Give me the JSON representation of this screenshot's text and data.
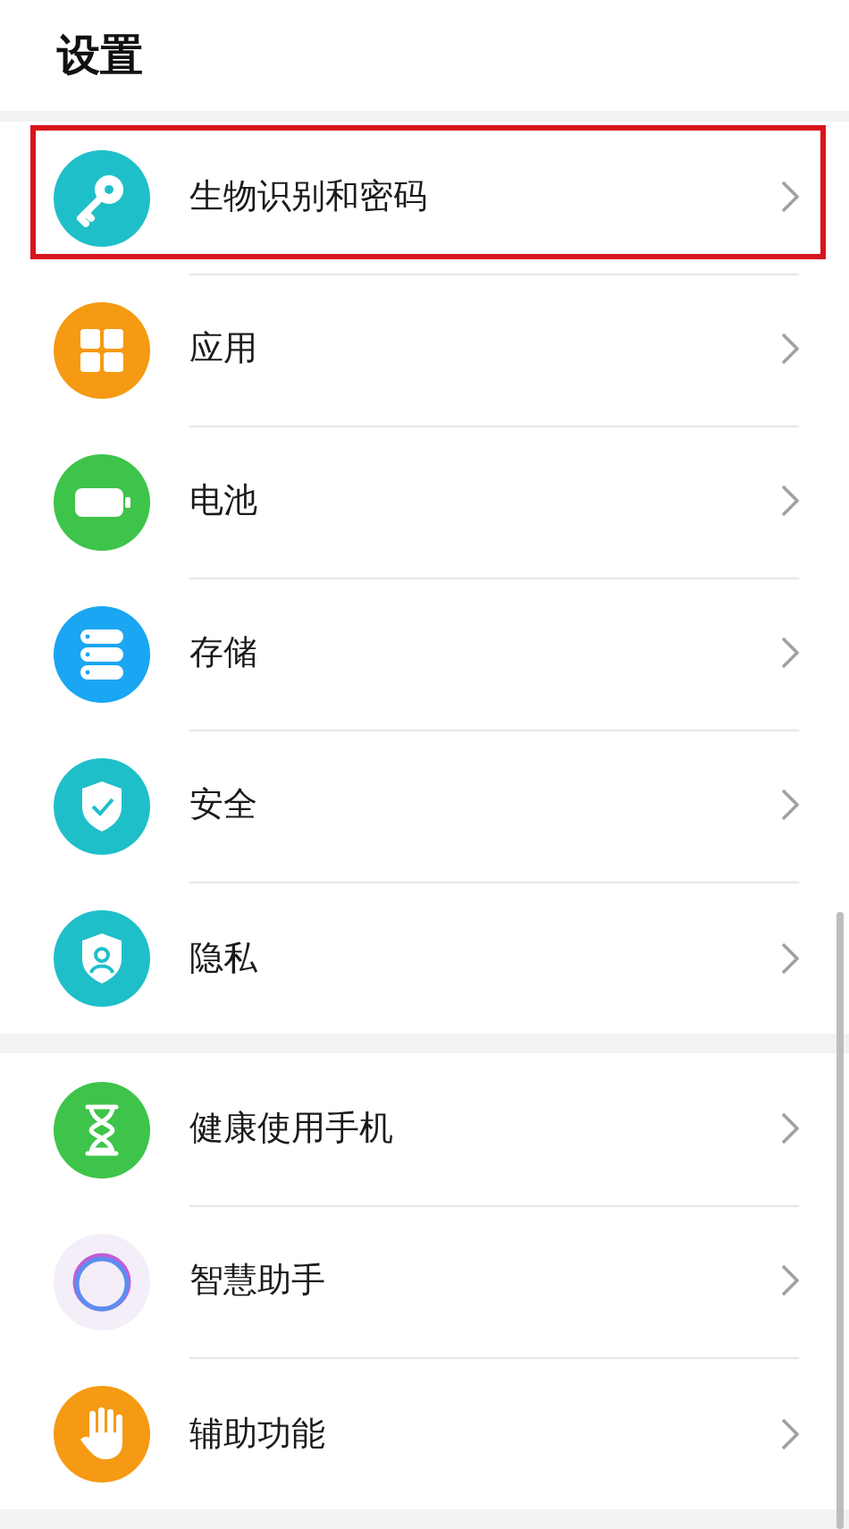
{
  "title": "设置",
  "groups": [
    {
      "items": [
        {
          "label": "生物识别和密码",
          "color": "#1fbfc9",
          "highlighted": true
        },
        {
          "label": "应用",
          "color": "#f59a12",
          "highlighted": false
        },
        {
          "label": "电池",
          "color": "#3ec44a",
          "highlighted": false
        },
        {
          "label": "存储",
          "color": "#1aa6f2",
          "highlighted": false
        },
        {
          "label": "安全",
          "color": "#1fbfc9",
          "highlighted": false
        },
        {
          "label": "隐私",
          "color": "#1fbfc9",
          "highlighted": false
        }
      ]
    },
    {
      "items": [
        {
          "label": "健康使用手机",
          "color": "#3ec44a",
          "highlighted": false
        },
        {
          "label": "智慧助手",
          "color": "#f3eef8",
          "highlighted": false
        },
        {
          "label": "辅助功能",
          "color": "#f59a12",
          "highlighted": false
        }
      ]
    }
  ]
}
